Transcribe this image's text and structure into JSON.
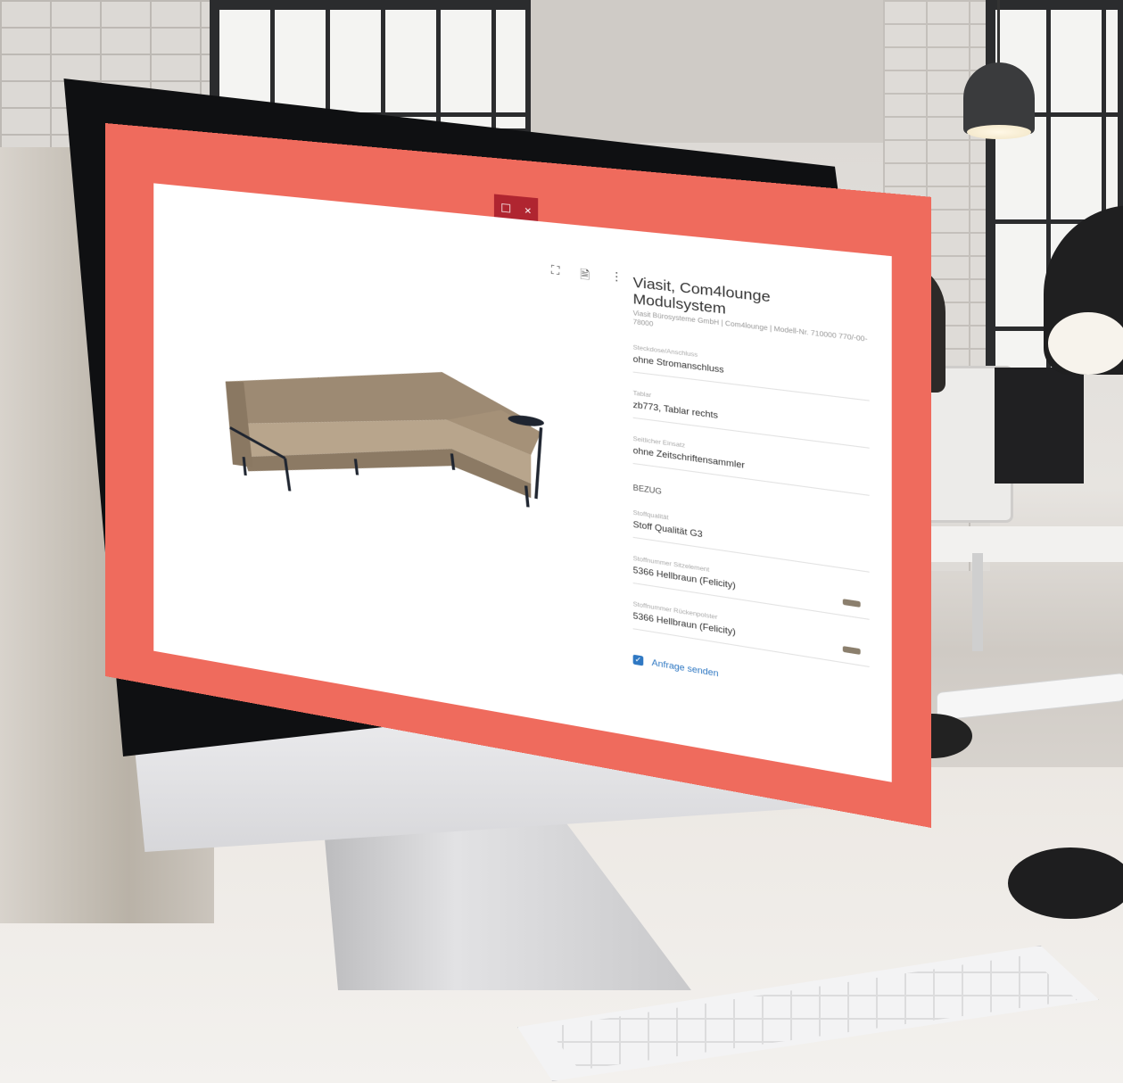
{
  "dialog": {
    "controls": {
      "maximize_glyph": "☐",
      "close_glyph": "×"
    },
    "toolbar": {
      "fullscreen_glyph": "⛶",
      "document_glyph": "🗎",
      "menu_glyph": "⋮"
    }
  },
  "product": {
    "title": "Viasit, Com4lounge Modulsystem",
    "subtitle": "Viasit Bürosysteme GmbH | Com4lounge | Modell-Nr. 710000 770/-00-78000",
    "fields": [
      {
        "label": "Steckdose/Anschluss",
        "value": "ohne Stromanschluss"
      },
      {
        "label": "Tablar",
        "value": "zb773, Tablar rechts"
      },
      {
        "label": "Seitlicher Einsatz",
        "value": "ohne Zeitschriftensammler"
      }
    ],
    "section_heading": "BEZUG",
    "cover_fields": [
      {
        "label": "Stoffqualität",
        "value": "Stoff Qualität G3",
        "swatch": false
      },
      {
        "label": "Stoffnummer Sitzelement",
        "value": "5366 Hellbraun (Felicity)",
        "swatch": true
      },
      {
        "label": "Stoffnummer Rückenpolster",
        "value": "5366 Hellbraun (Felicity)",
        "swatch": true
      }
    ],
    "send_label": "Anfrage senden",
    "swatch_color": "#8b7f6d",
    "accent_color": "#2f78c3",
    "frame_color": "#ef6b5d"
  }
}
